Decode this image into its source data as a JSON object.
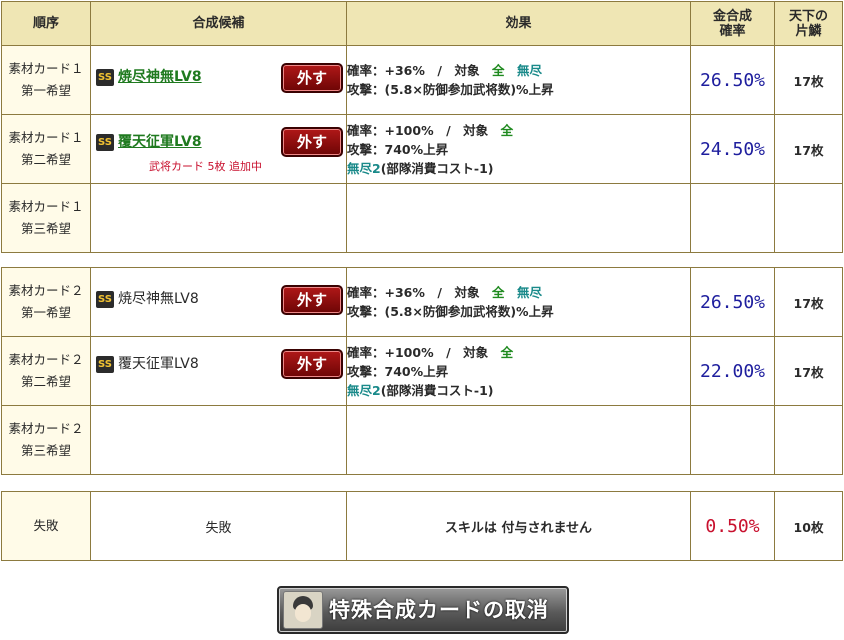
{
  "header": {
    "order": "順序",
    "candidate": "合成候補",
    "effect": "効果",
    "rate_line1": "金合成",
    "rate_line2": "確率",
    "count_line1": "天下の",
    "count_line2": "片鱗"
  },
  "group1": [
    {
      "order1": "素材カード１",
      "order2": "第一希望",
      "badge": "SS",
      "name": "焼尽神無LV8",
      "remove": "外す",
      "eff1_a": "確率：+36%　/　対象　",
      "eff1_b": "全",
      "eff1_c": "　無尽",
      "eff2": "攻撃：(5.8×防御参加武将数)%上昇",
      "rate": "26.50%",
      "count": "17枚"
    },
    {
      "order1": "素材カード１",
      "order2": "第二希望",
      "badge": "SS",
      "name": "覆天征軍LV8",
      "remove": "外す",
      "note": "武将カード 5枚 追加中",
      "eff1_a": "確率：+100%　/　対象　",
      "eff1_b": "全",
      "eff2": "攻撃：740%上昇",
      "eff3_a": "無尽2",
      "eff3_b": "(部隊消費コスト-1)",
      "rate": "24.50%",
      "count": "17枚"
    },
    {
      "order1": "素材カード１",
      "order2": "第三希望"
    }
  ],
  "group2": [
    {
      "order1": "素材カード２",
      "order2": "第一希望",
      "badge": "SS",
      "name": "焼尽神無LV8",
      "remove": "外す",
      "eff1_a": "確率：+36%　/　対象　",
      "eff1_b": "全",
      "eff1_c": "　無尽",
      "eff2": "攻撃：(5.8×防御参加武将数)%上昇",
      "rate": "26.50%",
      "count": "17枚"
    },
    {
      "order1": "素材カード２",
      "order2": "第二希望",
      "badge": "SS",
      "name": "覆天征軍LV8",
      "remove": "外す",
      "eff1_a": "確率：+100%　/　対象　",
      "eff1_b": "全",
      "eff2": "攻撃：740%上昇",
      "eff3_a": "無尽2",
      "eff3_b": "(部隊消費コスト-1)",
      "rate": "22.00%",
      "count": "17枚"
    },
    {
      "order1": "素材カード２",
      "order2": "第三希望"
    }
  ],
  "failure": {
    "order": "失敗",
    "candidate": "失敗",
    "effect": "スキルは 付与されません",
    "rate": "0.50%",
    "count": "10枚"
  },
  "cancel_button": "特殊合成カードの取消",
  "colors": {
    "header_bg": "#efe6b4",
    "border": "#8c7a3f",
    "rate_blue": "#1e1e9e",
    "rate_red": "#c8102e",
    "green": "#1f8a1f"
  }
}
